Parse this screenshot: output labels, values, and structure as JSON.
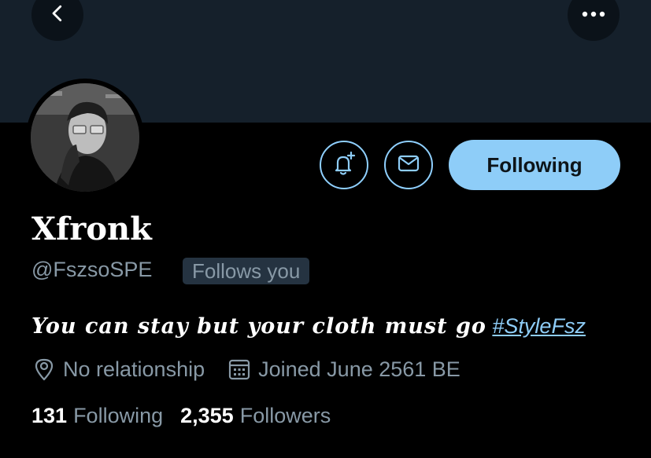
{
  "header": {
    "back_icon": "chevron-left-icon",
    "more_icon": "more-horizontal-icon",
    "banner_color": "#15202b"
  },
  "profile": {
    "display_name": "Xfronk",
    "handle": "@FszsoSPE",
    "follows_you_badge": "Follows you",
    "bio": {
      "text": "You can stay but your cloth must go",
      "hashtag": "#StyleFsz"
    },
    "location": "No relationship",
    "joined": "Joined June 2561 BE",
    "stats": {
      "following_count": "131",
      "following_label": "Following",
      "followers_count": "2,355",
      "followers_label": "Followers"
    }
  },
  "actions": {
    "notify_icon": "bell-plus-icon",
    "message_icon": "envelope-icon",
    "following_label": "Following"
  },
  "colors": {
    "accent": "#8ecdf8",
    "secondary_text": "#8899a6",
    "badge_bg": "#253341"
  }
}
